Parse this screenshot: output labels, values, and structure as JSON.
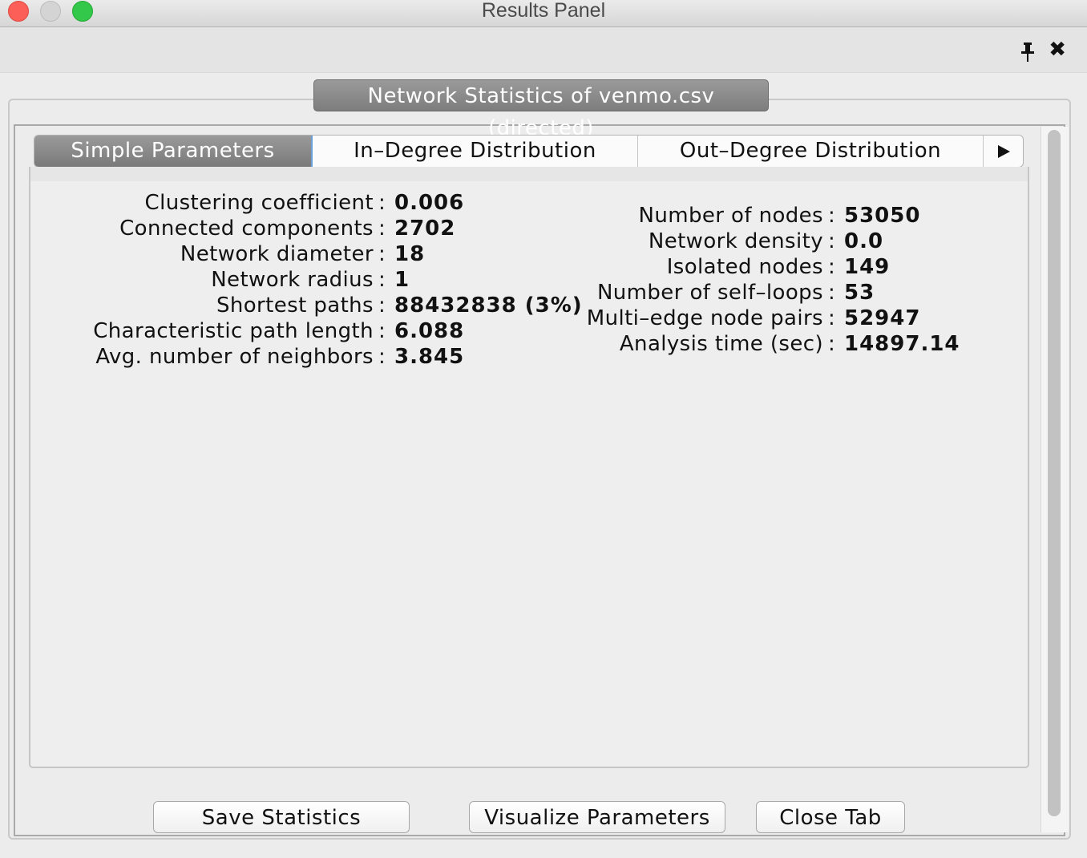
{
  "window": {
    "title": "Results Panel"
  },
  "group_title": "Network Statistics of venmo.csv (directed)",
  "tabs": [
    {
      "label": "Simple Parameters"
    },
    {
      "label": "In–Degree Distribution"
    },
    {
      "label": "Out–Degree Distribution"
    }
  ],
  "left_stats": [
    {
      "label": "Clustering coefficient",
      "value": "0.006"
    },
    {
      "label": "Connected components",
      "value": "2702"
    },
    {
      "label": "Network diameter",
      "value": "18"
    },
    {
      "label": "Network radius",
      "value": "1"
    },
    {
      "label": "Shortest paths",
      "value": "88432838 (3%)"
    },
    {
      "label": "Characteristic path length",
      "value": "6.088"
    },
    {
      "label": "Avg. number of neighbors",
      "value": "3.845"
    }
  ],
  "right_stats": [
    {
      "label": "Number of nodes",
      "value": "53050"
    },
    {
      "label": "Network density",
      "value": "0.0"
    },
    {
      "label": "Isolated nodes",
      "value": "149"
    },
    {
      "label": "Number of self–loops",
      "value": "53"
    },
    {
      "label": "Multi–edge node pairs",
      "value": "52947"
    },
    {
      "label": "Analysis time (sec)",
      "value": "14897.14"
    }
  ],
  "colon": ":",
  "buttons": {
    "save": "Save Statistics",
    "visualize": "Visualize Parameters",
    "close": "Close Tab"
  },
  "icons": {
    "pin": "pin-icon",
    "close": "close-icon",
    "more_tabs": "triangle-right-icon"
  }
}
